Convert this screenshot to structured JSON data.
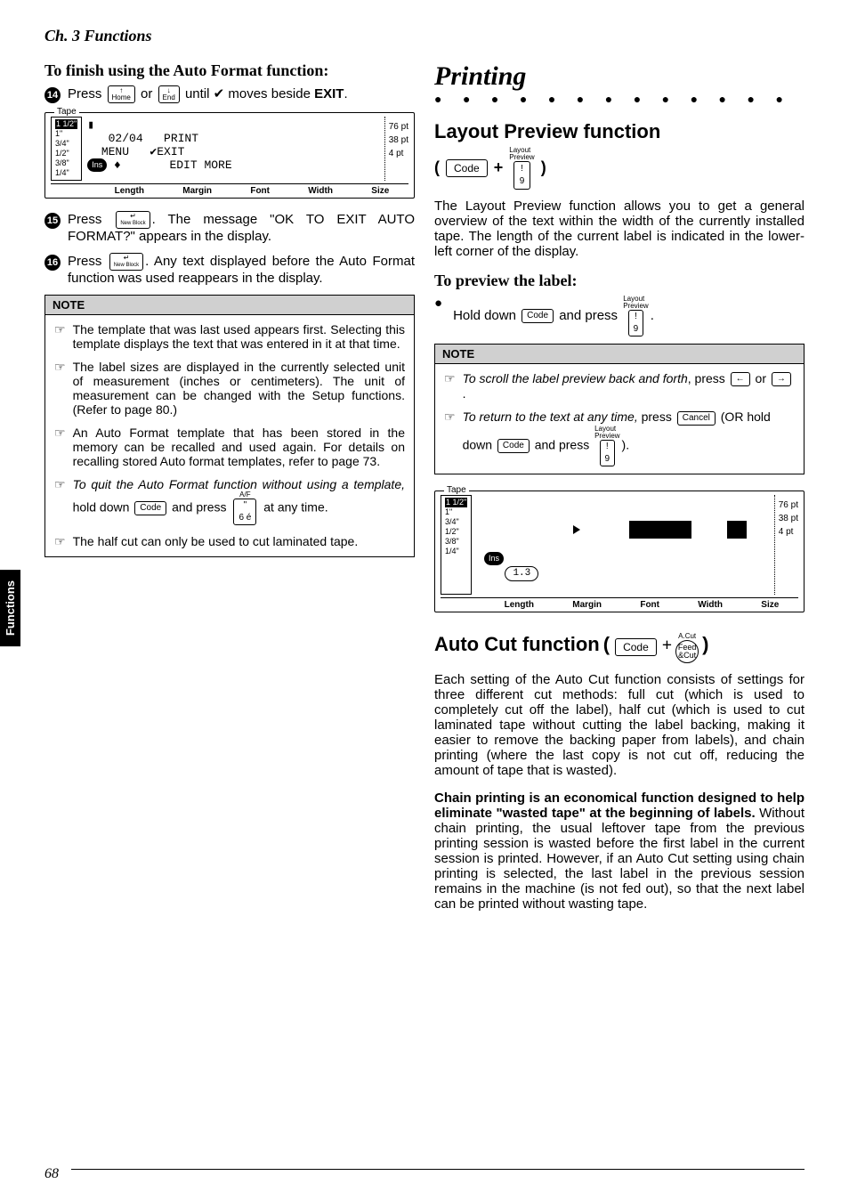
{
  "chapter_header": "Ch. 3 Functions",
  "left": {
    "heading1": "To finish using the Auto Format function:",
    "step14_num": "14",
    "step14_a": "Press ",
    "step14_b": " or ",
    "step14_c": " until ✔ moves beside ",
    "step14_exit": "EXIT",
    "step14_end": ".",
    "key_home_top": "↑",
    "key_home_bot": "Home",
    "key_end_top": "↓",
    "key_end_bot": "End",
    "lcd1": {
      "tape": "Tape",
      "left_lines": [
        "1 1/2\"",
        "1\"",
        "3/4\"",
        "1/2\"",
        "3/8\"",
        "1/4\""
      ],
      "left_hl_index": 0,
      "center": "▮\n   02/04   PRINT\n  MENU   ✔EXIT\n   ♦       EDIT MORE",
      "right": [
        "76 pt",
        "38 pt",
        "4 pt"
      ],
      "bottom": [
        "Length",
        "Margin",
        "Font",
        "Width",
        "Size"
      ],
      "ins": "Ins"
    },
    "step15_num": "15",
    "step15_a": "Press ",
    "step15_b": ". The message \"OK TO EXIT AUTO FORMAT?\" appears in the display.",
    "key_newblock_top": "↵",
    "key_newblock_bot": "New\nBlock",
    "step16_num": "16",
    "step16_a": "Press ",
    "step16_b": ". Any text displayed before the Auto Format function was used reappears in the display.",
    "note_label": "NOTE",
    "note_items": [
      "The template that was last used appears first. Selecting this template displays the text that was entered in it at that time.",
      "The label sizes are displayed in the currently selected unit of measurement (inches or centimeters). The unit of measurement can be changed with the Setup functions. (Refer to page 80.)",
      "An Auto Format template that has been stored in the memory can be recalled and used again. For details on recalling stored Auto format templates, refer to page 73."
    ],
    "note_item4_a": "To quit the Auto Format function without using a template,",
    "note_item4_b": " hold down ",
    "note_item4_c": " and press ",
    "note_item4_d": " at any time.",
    "key_code": "Code",
    "key_af_top": "A/F",
    "key_af_mid": "\"",
    "key_af_bot": "6 é",
    "note_item5": "The half cut can only be used to cut laminated tape."
  },
  "right": {
    "printing_title": "Printing",
    "layout_heading": "Layout Preview function",
    "key_code": "Code",
    "plus": "+",
    "key_lp_top": "Layout\nPreview",
    "key_lp_mid": "!",
    "key_lp_bot": "9",
    "layout_body": "The Layout Preview function allows you to get a general overview of the text within the width of the currently installed tape. The length of the current label is indicated in the lower-left corner of the display.",
    "preview_heading": "To preview the label:",
    "preview_step_a": "Hold down ",
    "preview_step_b": " and press ",
    "preview_step_c": ".",
    "note_label": "NOTE",
    "note2_item1_a": "To scroll the label preview back and forth",
    "note2_item1_b": ", press ",
    "note2_item1_c": " or ",
    "note2_item1_d": ".",
    "key_left": "←",
    "key_right": "→",
    "note2_item2_a": "To return to the text at any time,",
    "note2_item2_b": " press ",
    "note2_item2_c": " (OR hold down ",
    "note2_item2_d": " and press ",
    "note2_item2_e": ").",
    "key_cancel": "Cancel",
    "lcd2": {
      "tape": "Tape",
      "left_lines": [
        "1 1/2\"",
        "1\"",
        "3/4\"",
        "1/2\"",
        "3/8\"",
        "1/4\""
      ],
      "left_hl_index": 0,
      "length_bubble": "1.3",
      "right": [
        "76 pt",
        "38 pt",
        "4 pt"
      ],
      "bottom": [
        "Length",
        "Margin",
        "Font",
        "Width",
        "Size"
      ],
      "ins": "Ins"
    },
    "autocut_heading": "Auto Cut function",
    "key_feed_top": "A.Cut",
    "key_feed_l1": "Feed",
    "key_feed_l2": "&Cut",
    "autocut_body": "Each setting of the Auto Cut function consists of settings for three different cut methods: full cut (which is used to completely cut off the label), half cut (which is used to cut laminated tape without cutting the label backing, making it easier to remove the backing paper from labels), and chain printing (where the last copy is not cut off, reducing the amount of tape that is wasted).",
    "chain_bold": "Chain printing is an economical function designed to help eliminate \"wasted tape\" at the beginning of labels.",
    "chain_rest": " Without chain printing, the usual leftover tape from the previous printing session is wasted before the first label in the current session is printed. However, if an Auto Cut setting using chain printing is selected, the last label in the previous session remains in the machine (is not fed out), so that the next label can be printed without wasting tape."
  },
  "side_tab": "Functions",
  "page_number": "68"
}
